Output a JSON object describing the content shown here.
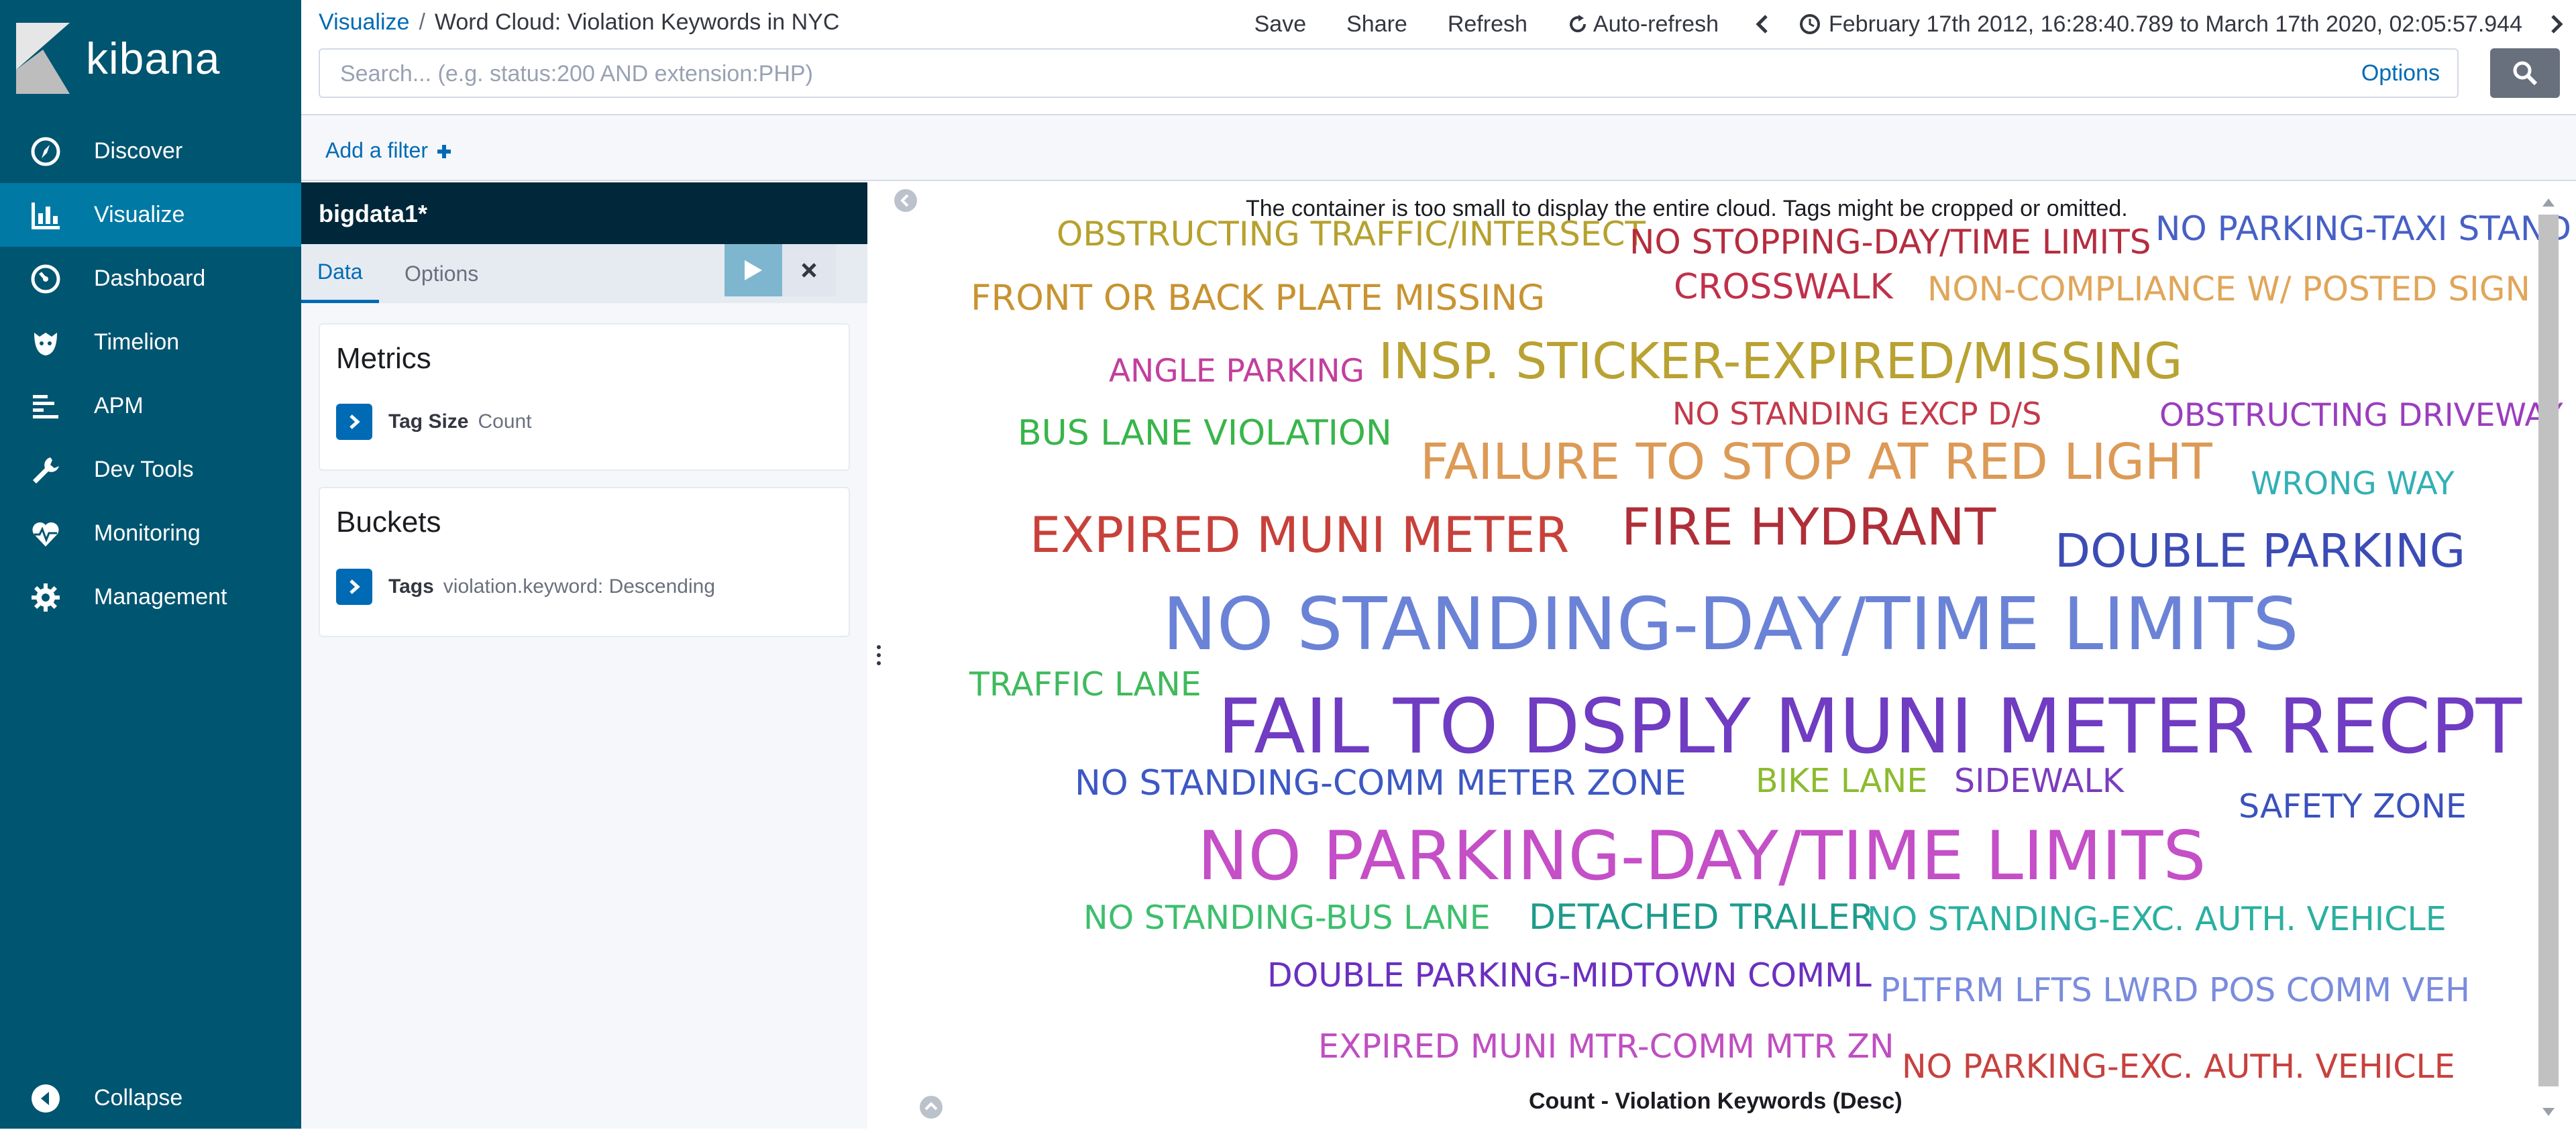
{
  "app": {
    "logo_text": "kibana"
  },
  "sidebar": {
    "items": [
      {
        "label": "Discover",
        "icon": "compass-icon"
      },
      {
        "label": "Visualize",
        "icon": "bar-chart-icon",
        "active": true
      },
      {
        "label": "Dashboard",
        "icon": "dashboard-icon"
      },
      {
        "label": "Timelion",
        "icon": "timelion-icon"
      },
      {
        "label": "APM",
        "icon": "apm-icon"
      },
      {
        "label": "Dev Tools",
        "icon": "wrench-icon"
      },
      {
        "label": "Monitoring",
        "icon": "heartbeat-icon"
      },
      {
        "label": "Management",
        "icon": "gear-icon"
      }
    ],
    "collapse_label": "Collapse"
  },
  "header": {
    "breadcrumb_root": "Visualize",
    "breadcrumb_separator": "/",
    "breadcrumb_current": "Word Cloud: Violation Keywords in NYC",
    "menu": {
      "save": "Save",
      "share": "Share",
      "refresh": "Refresh",
      "auto_refresh": "Auto-refresh"
    },
    "time_range": "February 17th 2012, 16:28:40.789 to March 17th 2020, 02:05:57.944"
  },
  "search": {
    "placeholder": "Search... (e.g. status:200 AND extension:PHP)",
    "value": "",
    "options_label": "Options"
  },
  "filter": {
    "add_filter_label": "Add a filter"
  },
  "editor": {
    "index_pattern": "bigdata1*",
    "tabs": {
      "data": "Data",
      "options": "Options"
    },
    "metrics": {
      "title": "Metrics",
      "agg_name": "Tag Size",
      "agg_desc": "Count"
    },
    "buckets": {
      "title": "Buckets",
      "agg_name": "Tags",
      "agg_desc": "violation.keyword: Descending"
    }
  },
  "viz": {
    "warning": "The container is too small to display the entire cloud. Tags might be cropped or omitted.",
    "legend_title": "Count - Violation Keywords (Desc)"
  },
  "chart_data": {
    "type": "wordcloud",
    "title": "",
    "words": [
      {
        "text": "FAIL TO DSPLY MUNI METER RECPT",
        "weight": 10.0,
        "color": "#6f3cc2"
      },
      {
        "text": "NO STANDING-DAY/TIME LIMITS",
        "weight": 9.6,
        "color": "#6b83d6"
      },
      {
        "text": "NO PARKING-DAY/TIME LIMITS",
        "weight": 9.0,
        "color": "#c44fc7"
      },
      {
        "text": "FIRE HYDRANT",
        "weight": 6.8,
        "color": "#b02e38"
      },
      {
        "text": "INSP. STICKER-EXPIRED/MISSING",
        "weight": 6.6,
        "color": "#b9a232"
      },
      {
        "text": "FAILURE TO STOP AT RED LIGHT",
        "weight": 6.6,
        "color": "#dc9a56"
      },
      {
        "text": "EXPIRED MUNI METER",
        "weight": 6.5,
        "color": "#c8403a"
      },
      {
        "text": "DOUBLE PARKING",
        "weight": 6.2,
        "color": "#3c4cb5"
      },
      {
        "text": "FRONT OR BACK PLATE MISSING",
        "weight": 4.7,
        "color": "#c89330"
      },
      {
        "text": "BUS LANE VIOLATION",
        "weight": 4.6,
        "color": "#38b54a"
      },
      {
        "text": "NO STANDING-COMM METER ZONE",
        "weight": 4.6,
        "color": "#3d58c4"
      },
      {
        "text": "CROSSWALK",
        "weight": 4.6,
        "color": "#c0304a"
      },
      {
        "text": "DETACHED TRAILER",
        "weight": 4.6,
        "color": "#1d9b8c"
      },
      {
        "text": "OBSTRUCTING TRAFFIC/INTERSECT",
        "weight": 4.5,
        "color": "#b6a12e"
      },
      {
        "text": "NON-COMPLIANCE W/ POSTED SIGN",
        "weight": 4.5,
        "color": "#e0a65a"
      },
      {
        "text": "NO STOPPING-DAY/TIME LIMITS",
        "weight": 4.5,
        "color": "#b52c3e"
      },
      {
        "text": "NO PARKING-TAXI STAND",
        "weight": 4.5,
        "color": "#4760c6"
      },
      {
        "text": "TRAFFIC LANE",
        "weight": 4.4,
        "color": "#3fba5c"
      },
      {
        "text": "BIKE LANE",
        "weight": 4.4,
        "color": "#8cbb2e"
      },
      {
        "text": "SIDEWALK",
        "weight": 4.4,
        "color": "#7a3cbd"
      },
      {
        "text": "SAFETY ZONE",
        "weight": 4.4,
        "color": "#3a51bd"
      },
      {
        "text": "NO STANDING-BUS LANE",
        "weight": 4.4,
        "color": "#3dbf6e"
      },
      {
        "text": "NO STANDING-EXC. AUTH. VEHICLE",
        "weight": 4.4,
        "color": "#2ab0a0"
      },
      {
        "text": "DOUBLE PARKING-MIDTOWN COMML",
        "weight": 4.4,
        "color": "#6b2fc0"
      },
      {
        "text": "PLTFRM LFTS LWRD POS COMM VEH",
        "weight": 4.4,
        "color": "#7a8cde"
      },
      {
        "text": "EXPIRED MUNI MTR-COMM MTR ZN",
        "weight": 4.4,
        "color": "#c04ec2"
      },
      {
        "text": "NO PARKING-EXC. AUTH. VEHICLE",
        "weight": 4.4,
        "color": "#c7413e"
      },
      {
        "text": "ANGLE PARKING",
        "weight": 4.2,
        "color": "#c23f9e"
      },
      {
        "text": "NO STANDING EXCP D/S",
        "weight": 4.1,
        "color": "#c33a4a"
      },
      {
        "text": "OBSTRUCTING DRIVEWAY",
        "weight": 4.2,
        "color": "#9b3dbe"
      },
      {
        "text": "WRONG WAY",
        "weight": 4.2,
        "color": "#33b0b6"
      }
    ]
  }
}
